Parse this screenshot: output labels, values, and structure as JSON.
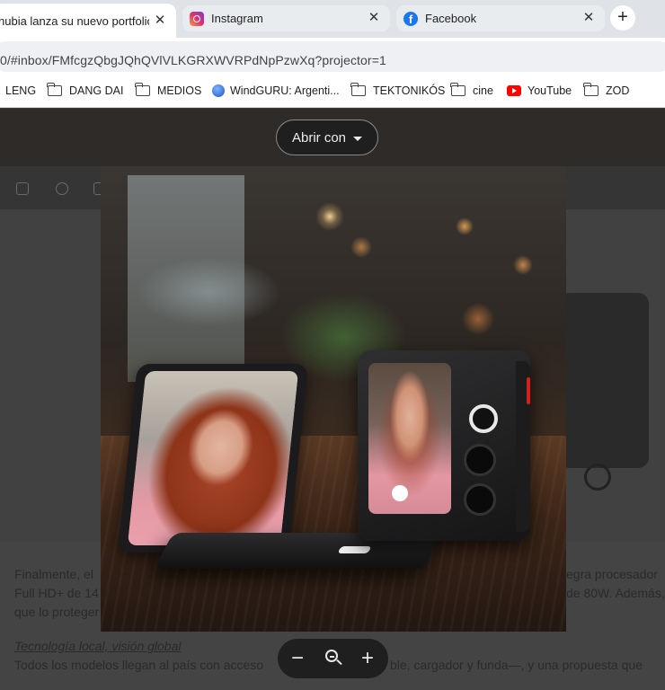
{
  "tabs": [
    {
      "label": "nubia lanza su nuevo portfolio",
      "icon": "document-icon",
      "active": true
    },
    {
      "label": "Instagram",
      "icon": "instagram-icon",
      "active": false
    },
    {
      "label": "Facebook",
      "icon": "facebook-icon",
      "active": false
    }
  ],
  "address": {
    "url": "0/#inbox/FMfcgzQbgJQhQVlVLKGRXWVRPdNpPzwXq?projector=1"
  },
  "bookmarks": [
    {
      "label": "LENG",
      "icon": "folder-icon"
    },
    {
      "label": "DANG DAI",
      "icon": "folder-icon"
    },
    {
      "label": "MEDIOS",
      "icon": "folder-icon"
    },
    {
      "label": "WindGURU: Argenti...",
      "icon": "windguru-icon"
    },
    {
      "label": "TEKTONIKÓS",
      "icon": "folder-icon"
    },
    {
      "label": "cine",
      "icon": "folder-icon"
    },
    {
      "label": "YouTube",
      "icon": "youtube-icon"
    },
    {
      "label": "ZOD",
      "icon": "folder-icon"
    }
  ],
  "viewer": {
    "open_with_label": "Abrir con",
    "zoom_out_symbol": "−",
    "zoom_in_symbol": "+"
  },
  "article": {
    "line1_left": "Finalmente, el",
    "line1_right": "egra procesador",
    "line2_left": "Full HD+ de 14",
    "line2_right": "de 80W. Además,",
    "line3_left": "que lo proteger",
    "subheading": "Tecnología local, visión global",
    "line4": "Todos los modelos llegan al país con acceso",
    "line4_right": "ble, cargador y funda—, y una propuesta que"
  },
  "colors": {
    "tabstrip": "#dfe3e8",
    "viewer_backdrop": "#414141",
    "button_dark": "#1f1f1f"
  }
}
